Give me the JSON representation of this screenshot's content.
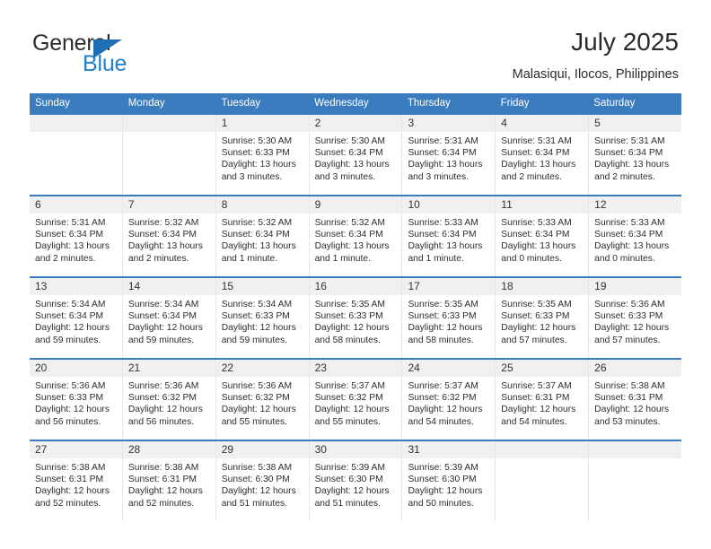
{
  "brand": {
    "name_top": "General",
    "name_bottom": "Blue",
    "triangle_color": "#1f6fb5",
    "blue_color": "#1f7fd0"
  },
  "header": {
    "title": "July 2025",
    "subtitle": "Malasiqui, Ilocos, Philippines"
  },
  "theme": {
    "header_bar": "#3a7cbe",
    "day_band": "#f0f0f0",
    "text": "#2d2d2d"
  },
  "weekdays": [
    "Sunday",
    "Monday",
    "Tuesday",
    "Wednesday",
    "Thursday",
    "Friday",
    "Saturday"
  ],
  "calendar": {
    "month": "July",
    "year": "2025",
    "location": "Malasiqui, Ilocos, Philippines",
    "weeks": [
      [
        {
          "day": "",
          "sunrise": "",
          "sunset": "",
          "daylight1": "",
          "daylight2": ""
        },
        {
          "day": "",
          "sunrise": "",
          "sunset": "",
          "daylight1": "",
          "daylight2": ""
        },
        {
          "day": "1",
          "sunrise": "Sunrise: 5:30 AM",
          "sunset": "Sunset: 6:33 PM",
          "daylight1": "Daylight: 13 hours",
          "daylight2": "and 3 minutes."
        },
        {
          "day": "2",
          "sunrise": "Sunrise: 5:30 AM",
          "sunset": "Sunset: 6:34 PM",
          "daylight1": "Daylight: 13 hours",
          "daylight2": "and 3 minutes."
        },
        {
          "day": "3",
          "sunrise": "Sunrise: 5:31 AM",
          "sunset": "Sunset: 6:34 PM",
          "daylight1": "Daylight: 13 hours",
          "daylight2": "and 3 minutes."
        },
        {
          "day": "4",
          "sunrise": "Sunrise: 5:31 AM",
          "sunset": "Sunset: 6:34 PM",
          "daylight1": "Daylight: 13 hours",
          "daylight2": "and 2 minutes."
        },
        {
          "day": "5",
          "sunrise": "Sunrise: 5:31 AM",
          "sunset": "Sunset: 6:34 PM",
          "daylight1": "Daylight: 13 hours",
          "daylight2": "and 2 minutes."
        }
      ],
      [
        {
          "day": "6",
          "sunrise": "Sunrise: 5:31 AM",
          "sunset": "Sunset: 6:34 PM",
          "daylight1": "Daylight: 13 hours",
          "daylight2": "and 2 minutes."
        },
        {
          "day": "7",
          "sunrise": "Sunrise: 5:32 AM",
          "sunset": "Sunset: 6:34 PM",
          "daylight1": "Daylight: 13 hours",
          "daylight2": "and 2 minutes."
        },
        {
          "day": "8",
          "sunrise": "Sunrise: 5:32 AM",
          "sunset": "Sunset: 6:34 PM",
          "daylight1": "Daylight: 13 hours",
          "daylight2": "and 1 minute."
        },
        {
          "day": "9",
          "sunrise": "Sunrise: 5:32 AM",
          "sunset": "Sunset: 6:34 PM",
          "daylight1": "Daylight: 13 hours",
          "daylight2": "and 1 minute."
        },
        {
          "day": "10",
          "sunrise": "Sunrise: 5:33 AM",
          "sunset": "Sunset: 6:34 PM",
          "daylight1": "Daylight: 13 hours",
          "daylight2": "and 1 minute."
        },
        {
          "day": "11",
          "sunrise": "Sunrise: 5:33 AM",
          "sunset": "Sunset: 6:34 PM",
          "daylight1": "Daylight: 13 hours",
          "daylight2": "and 0 minutes."
        },
        {
          "day": "12",
          "sunrise": "Sunrise: 5:33 AM",
          "sunset": "Sunset: 6:34 PM",
          "daylight1": "Daylight: 13 hours",
          "daylight2": "and 0 minutes."
        }
      ],
      [
        {
          "day": "13",
          "sunrise": "Sunrise: 5:34 AM",
          "sunset": "Sunset: 6:34 PM",
          "daylight1": "Daylight: 12 hours",
          "daylight2": "and 59 minutes."
        },
        {
          "day": "14",
          "sunrise": "Sunrise: 5:34 AM",
          "sunset": "Sunset: 6:34 PM",
          "daylight1": "Daylight: 12 hours",
          "daylight2": "and 59 minutes."
        },
        {
          "day": "15",
          "sunrise": "Sunrise: 5:34 AM",
          "sunset": "Sunset: 6:33 PM",
          "daylight1": "Daylight: 12 hours",
          "daylight2": "and 59 minutes."
        },
        {
          "day": "16",
          "sunrise": "Sunrise: 5:35 AM",
          "sunset": "Sunset: 6:33 PM",
          "daylight1": "Daylight: 12 hours",
          "daylight2": "and 58 minutes."
        },
        {
          "day": "17",
          "sunrise": "Sunrise: 5:35 AM",
          "sunset": "Sunset: 6:33 PM",
          "daylight1": "Daylight: 12 hours",
          "daylight2": "and 58 minutes."
        },
        {
          "day": "18",
          "sunrise": "Sunrise: 5:35 AM",
          "sunset": "Sunset: 6:33 PM",
          "daylight1": "Daylight: 12 hours",
          "daylight2": "and 57 minutes."
        },
        {
          "day": "19",
          "sunrise": "Sunrise: 5:36 AM",
          "sunset": "Sunset: 6:33 PM",
          "daylight1": "Daylight: 12 hours",
          "daylight2": "and 57 minutes."
        }
      ],
      [
        {
          "day": "20",
          "sunrise": "Sunrise: 5:36 AM",
          "sunset": "Sunset: 6:33 PM",
          "daylight1": "Daylight: 12 hours",
          "daylight2": "and 56 minutes."
        },
        {
          "day": "21",
          "sunrise": "Sunrise: 5:36 AM",
          "sunset": "Sunset: 6:32 PM",
          "daylight1": "Daylight: 12 hours",
          "daylight2": "and 56 minutes."
        },
        {
          "day": "22",
          "sunrise": "Sunrise: 5:36 AM",
          "sunset": "Sunset: 6:32 PM",
          "daylight1": "Daylight: 12 hours",
          "daylight2": "and 55 minutes."
        },
        {
          "day": "23",
          "sunrise": "Sunrise: 5:37 AM",
          "sunset": "Sunset: 6:32 PM",
          "daylight1": "Daylight: 12 hours",
          "daylight2": "and 55 minutes."
        },
        {
          "day": "24",
          "sunrise": "Sunrise: 5:37 AM",
          "sunset": "Sunset: 6:32 PM",
          "daylight1": "Daylight: 12 hours",
          "daylight2": "and 54 minutes."
        },
        {
          "day": "25",
          "sunrise": "Sunrise: 5:37 AM",
          "sunset": "Sunset: 6:31 PM",
          "daylight1": "Daylight: 12 hours",
          "daylight2": "and 54 minutes."
        },
        {
          "day": "26",
          "sunrise": "Sunrise: 5:38 AM",
          "sunset": "Sunset: 6:31 PM",
          "daylight1": "Daylight: 12 hours",
          "daylight2": "and 53 minutes."
        }
      ],
      [
        {
          "day": "27",
          "sunrise": "Sunrise: 5:38 AM",
          "sunset": "Sunset: 6:31 PM",
          "daylight1": "Daylight: 12 hours",
          "daylight2": "and 52 minutes."
        },
        {
          "day": "28",
          "sunrise": "Sunrise: 5:38 AM",
          "sunset": "Sunset: 6:31 PM",
          "daylight1": "Daylight: 12 hours",
          "daylight2": "and 52 minutes."
        },
        {
          "day": "29",
          "sunrise": "Sunrise: 5:38 AM",
          "sunset": "Sunset: 6:30 PM",
          "daylight1": "Daylight: 12 hours",
          "daylight2": "and 51 minutes."
        },
        {
          "day": "30",
          "sunrise": "Sunrise: 5:39 AM",
          "sunset": "Sunset: 6:30 PM",
          "daylight1": "Daylight: 12 hours",
          "daylight2": "and 51 minutes."
        },
        {
          "day": "31",
          "sunrise": "Sunrise: 5:39 AM",
          "sunset": "Sunset: 6:30 PM",
          "daylight1": "Daylight: 12 hours",
          "daylight2": "and 50 minutes."
        },
        {
          "day": "",
          "sunrise": "",
          "sunset": "",
          "daylight1": "",
          "daylight2": ""
        },
        {
          "day": "",
          "sunrise": "",
          "sunset": "",
          "daylight1": "",
          "daylight2": ""
        }
      ]
    ]
  }
}
